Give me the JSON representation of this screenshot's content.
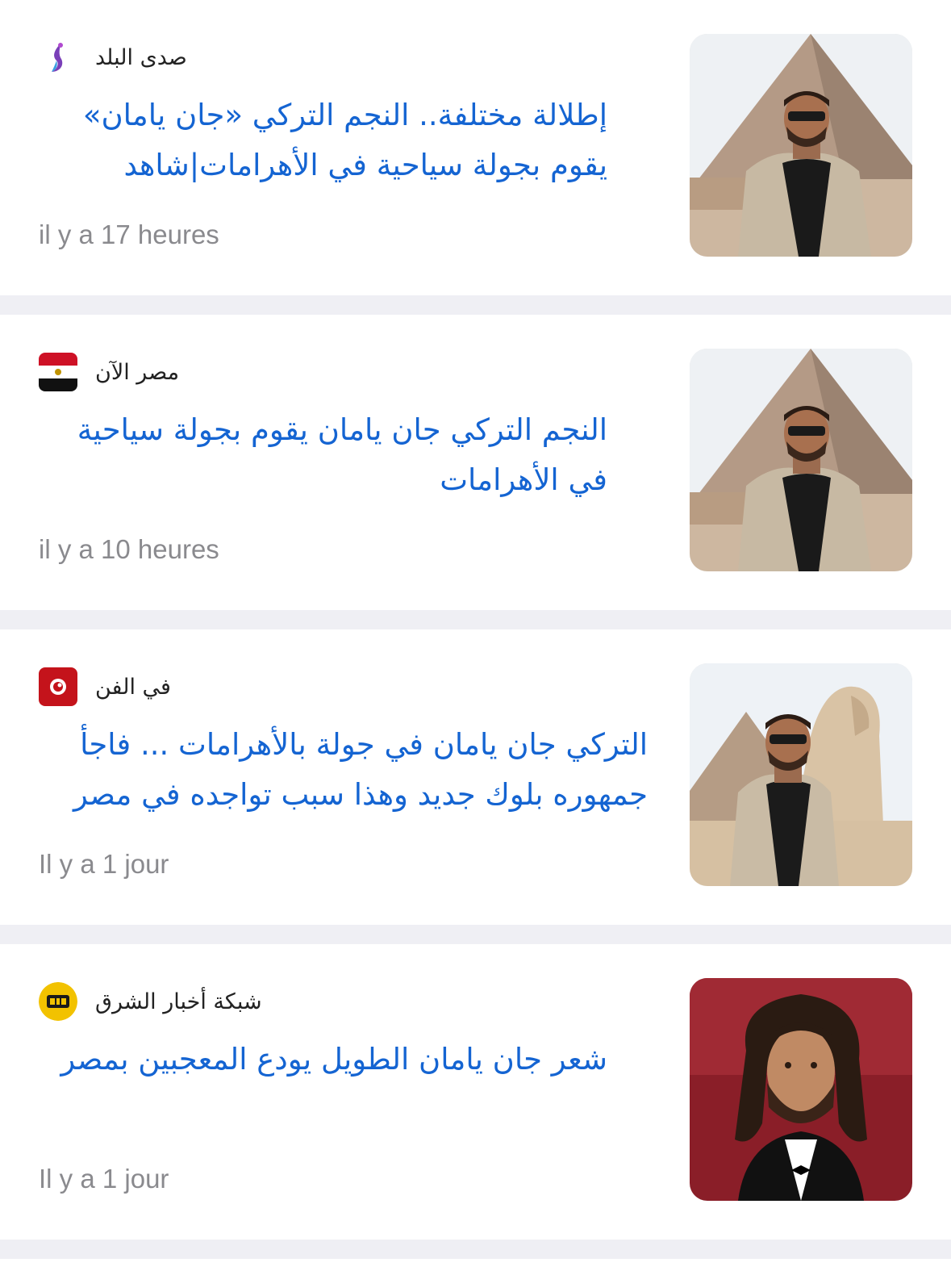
{
  "articles": [
    {
      "source": "صدى البلد",
      "source_icon": "sada-elbalad-logo-icon",
      "headline": "إطلالة مختلفة.. النجم التركي «جان يامان» يقوم بجولة سياحية في الأهرامات|شاهد",
      "time": "il y a 17 heures",
      "thumbnail": "man-at-pyramid-photo"
    },
    {
      "source": "مصر الآن",
      "source_icon": "egypt-flag-icon",
      "headline": "النجم التركي جان يامان يقوم بجولة سياحية في الأهرامات",
      "time": "il y a 10 heures",
      "thumbnail": "man-at-pyramid-photo"
    },
    {
      "source": "في الفن",
      "source_icon": "fil-fan-logo-icon",
      "headline": "التركي جان يامان في جولة بالأهرامات ... فاجأ جمهوره بلوك جديد وهذا سبب تواجده في مصر",
      "time": "Il y a 1 jour",
      "thumbnail": "man-at-sphinx-photo"
    },
    {
      "source": "شبكة أخبار الشرق",
      "source_icon": "sharq-news-logo-icon",
      "headline": "شعر جان يامان الطويل يودع المعجبين بمصر",
      "time": "Il y a 1 jour",
      "thumbnail": "man-long-hair-portrait-photo"
    }
  ],
  "colors": {
    "headline": "#1464d2",
    "time": "#8a8a8e",
    "separator": "#efeff4"
  }
}
